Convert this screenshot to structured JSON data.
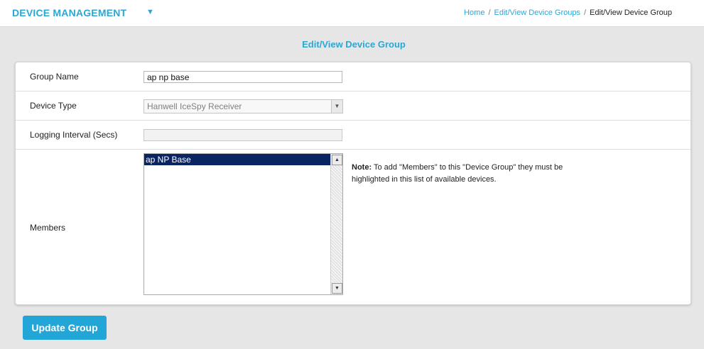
{
  "header": {
    "app_title": "DEVICE MANAGEMENT",
    "caret_icon": "caret-down-icon"
  },
  "breadcrumb": {
    "home": "Home",
    "separator": "/",
    "groups": "Edit/View Device Groups",
    "current": "Edit/View Device Group"
  },
  "page": {
    "title": "Edit/View Device Group"
  },
  "form": {
    "group_name": {
      "label": "Group Name",
      "value": "ap np base"
    },
    "device_type": {
      "label": "Device Type",
      "value": "Hanwell IceSpy Receiver"
    },
    "logging_interval": {
      "label": "Logging Interval (Secs)",
      "value": ""
    },
    "members": {
      "label": "Members",
      "items": [
        "ap NP Base"
      ],
      "selected": "ap NP Base"
    },
    "note": {
      "prefix": "Note:",
      "text": " To add \"Members\" to this \"Device Group\" they must be highlighted in this list of available devices."
    }
  },
  "actions": {
    "update_label": "Update Group"
  },
  "colors": {
    "accent": "#2aa7d3",
    "button": "#22a6d7",
    "selection": "#0a2463",
    "background": "#e6e6e6"
  }
}
